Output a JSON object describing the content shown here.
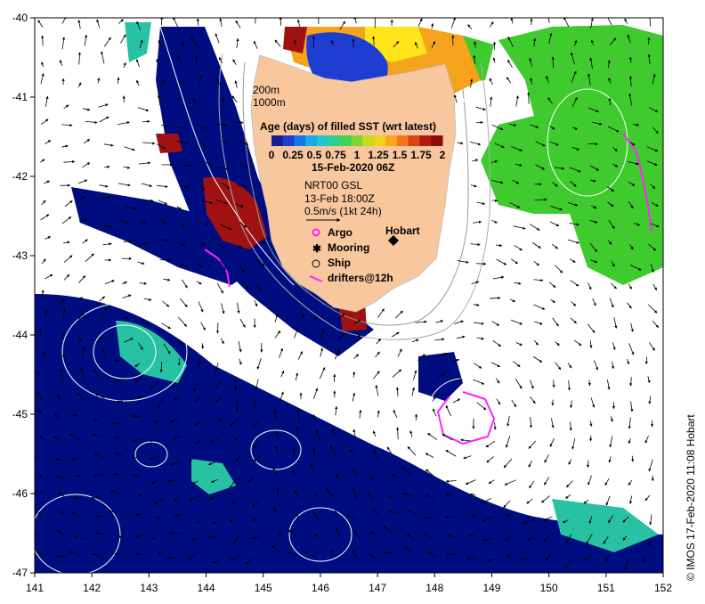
{
  "map": {
    "lon_ticks": [
      "141",
      "142",
      "143",
      "144",
      "145",
      "146",
      "147",
      "148",
      "149",
      "150",
      "151",
      "152"
    ],
    "lat_ticks": [
      "-40",
      "-41",
      "-42",
      "-43",
      "-44",
      "-45",
      "-46",
      "-47"
    ],
    "lon_range": [
      141,
      152
    ],
    "lat_range": [
      -47,
      -40
    ],
    "colors": {
      "land": "#f9c79e",
      "deep_blue": "#000d80",
      "teal": "#29c1a3",
      "green": "#3fca2e",
      "dark_red": "#a01212",
      "orange": "#f5a31c",
      "yellow": "#ffe51a",
      "drifter": "#ff22ff"
    }
  },
  "legend": {
    "isobaths": [
      "200m",
      "1000m"
    ],
    "colorbar_title": "Age (days) of filled SST (wrt latest)",
    "colorbar_ticks": [
      "0",
      "0.25",
      "0.5",
      "0.75",
      "1",
      "1.25",
      "1.5",
      "1.75",
      "2"
    ],
    "colorbar_colors": [
      "#1b1c8e",
      "#1d3ed0",
      "#1577e6",
      "#1ea9ec",
      "#22c7c9",
      "#2dce92",
      "#3fd15a",
      "#7fd62c",
      "#c6db1e",
      "#f0d21c",
      "#f7a91b",
      "#f1761a",
      "#dc4417",
      "#b71a14",
      "#8c0a0a"
    ],
    "date": "15-Feb-2020 06Z",
    "source": "NRT00 GSL",
    "current_time": "13-Feb 18:00Z",
    "vector_scale": "0.5m/s (1kt 24h)",
    "city": "Hobart",
    "symbols": [
      "Argo",
      "Mooring",
      "Ship",
      "drifters@12h"
    ]
  },
  "credit": "© IMOS 17-Feb-2020 11:08 Hobart"
}
